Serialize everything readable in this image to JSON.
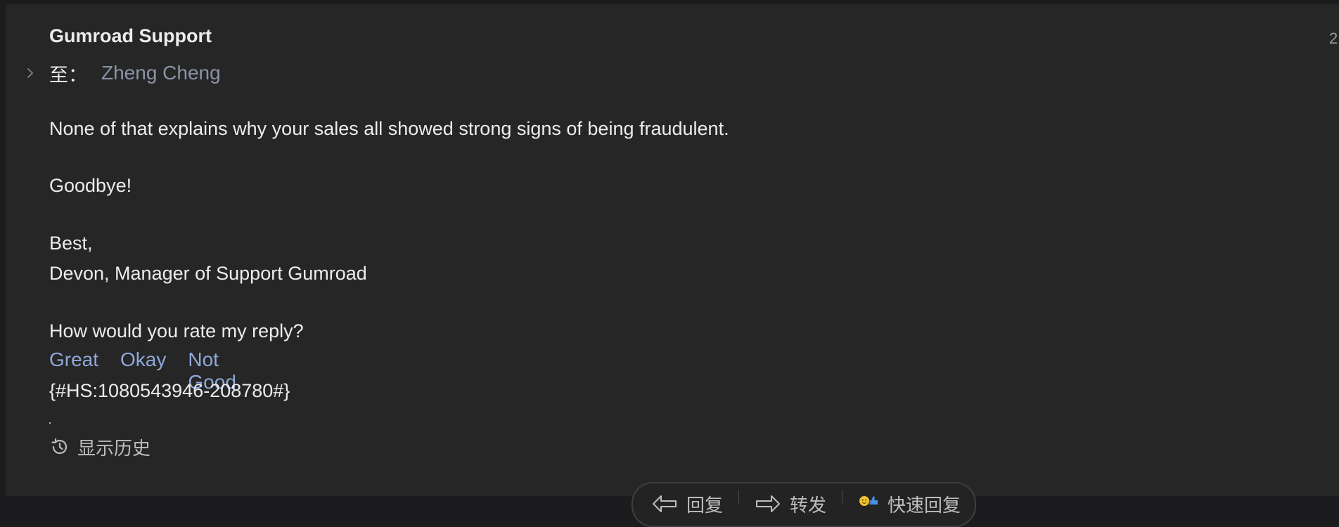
{
  "header": {
    "sender": "Gumroad Support",
    "date_stub": "2",
    "to_label": "至：",
    "recipient": "Zheng Cheng"
  },
  "message": {
    "line1": "None of that explains why your sales all showed strong signs of being fraudulent.",
    "line2": "Goodbye!",
    "closing": "Best,",
    "signature": "Devon, Manager of Support Gumroad",
    "rating_prompt": "How would you rate my reply?",
    "rating_options": [
      "Great",
      "Okay",
      "Not Good"
    ],
    "ticket_ref": "{#HS:1080543946-208780#}"
  },
  "history": {
    "label": "显示历史"
  },
  "actions": {
    "reply": "回复",
    "forward": "转发",
    "quick_reply": "快速回复"
  },
  "colors": {
    "background": "#262626",
    "text": "#ececec",
    "link": "#8ea8d8",
    "recipient": "#8b93a6"
  }
}
